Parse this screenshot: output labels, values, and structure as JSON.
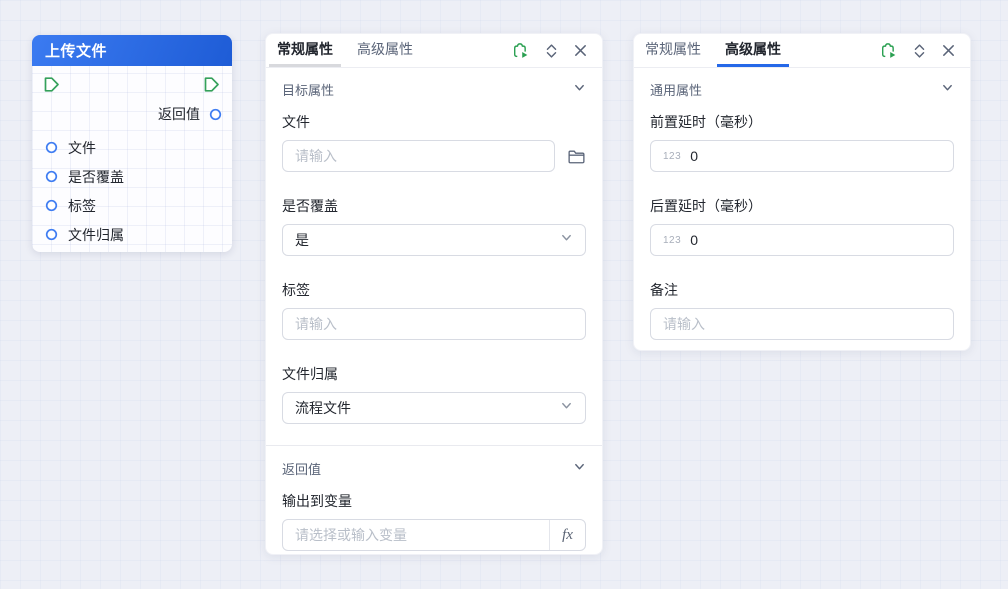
{
  "colors": {
    "accent_blue": "#2568E8",
    "node_header_gradient_start": "#3B7BF1",
    "node_header_gradient_end": "#1E5CD6",
    "flow_port_green": "#35A15B",
    "data_port_blue": "#3F7DF2",
    "icon_gray": "#5A6478",
    "debug_icon_green": "#2BA052"
  },
  "node_card": {
    "title": "上传文件",
    "output_port": "返回值",
    "input_ports": [
      "文件",
      "是否覆盖",
      "标签",
      "文件归属"
    ]
  },
  "general_panel": {
    "tabs": {
      "general": "常规属性",
      "advanced": "高级属性"
    },
    "target_section_title": "目标属性",
    "fields": {
      "file": {
        "label": "文件",
        "placeholder": "请输入"
      },
      "overwrite": {
        "label": "是否覆盖",
        "value": "是"
      },
      "tag": {
        "label": "标签",
        "placeholder": "请输入"
      },
      "file_belong": {
        "label": "文件归属",
        "value": "流程文件"
      }
    },
    "return_section_title": "返回值",
    "output_field": {
      "label": "输出到变量",
      "placeholder": "请选择或输入变量",
      "fx_label": "fx"
    }
  },
  "advanced_panel": {
    "tabs": {
      "general": "常规属性",
      "advanced": "高级属性"
    },
    "section_title": "通用属性",
    "fields": {
      "pre_delay": {
        "label": "前置延时（毫秒）",
        "value": "0",
        "prefix": "123"
      },
      "post_delay": {
        "label": "后置延时（毫秒）",
        "value": "0",
        "prefix": "123"
      },
      "remark": {
        "label": "备注",
        "placeholder": "请输入"
      }
    }
  }
}
